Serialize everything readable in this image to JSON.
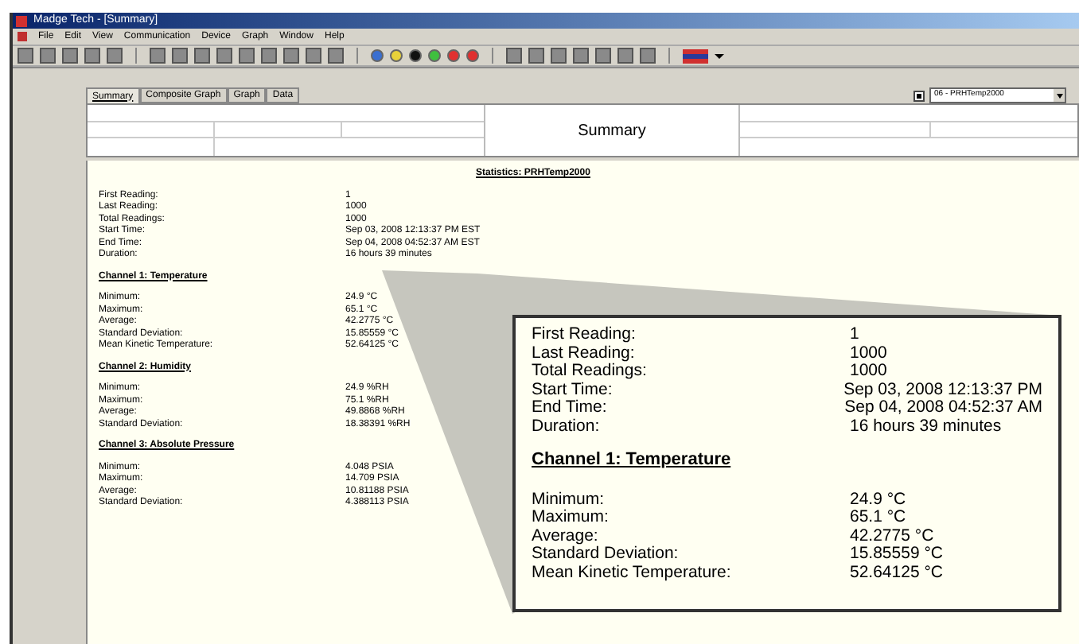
{
  "window": {
    "title": "Madge Tech - [Summary]"
  },
  "menu": [
    "File",
    "Edit",
    "View",
    "Communication",
    "Device",
    "Graph",
    "Window",
    "Help"
  ],
  "tabs": [
    {
      "label": "Summary",
      "selected": true
    },
    {
      "label": "Composite Graph",
      "selected": false
    },
    {
      "label": "Graph",
      "selected": false
    },
    {
      "label": "Data",
      "selected": false
    }
  ],
  "device_select": {
    "checked": true,
    "value": "06 - PRHTemp2000"
  },
  "header": {
    "title": "Summary"
  },
  "report": {
    "title": "Statistics: PRHTemp2000",
    "general": [
      {
        "label": "First Reading:",
        "value": "1"
      },
      {
        "label": "Last Reading:",
        "value": "1000"
      },
      {
        "label": "Total Readings:",
        "value": "1000"
      },
      {
        "label": "Start Time:",
        "value": "Sep 03, 2008 12:13:37 PM EST"
      },
      {
        "label": "End Time:",
        "value": "Sep 04, 2008 04:52:37 AM EST"
      },
      {
        "label": "Duration:",
        "value": "16 hours 39 minutes"
      }
    ],
    "channels": [
      {
        "title": "Channel 1: Temperature",
        "rows": [
          {
            "label": "Minimum:",
            "value": "24.9 °C"
          },
          {
            "label": "Maximum:",
            "value": "65.1 °C"
          },
          {
            "label": "Average:",
            "value": "42.2775 °C"
          },
          {
            "label": "Standard Deviation:",
            "value": "15.85559 °C"
          },
          {
            "label": "Mean Kinetic Temperature:",
            "value": "52.64125 °C"
          }
        ]
      },
      {
        "title": "Channel 2: Humidity",
        "rows": [
          {
            "label": "Minimum:",
            "value": "24.9 %RH"
          },
          {
            "label": "Maximum:",
            "value": "75.1 %RH"
          },
          {
            "label": "Average:",
            "value": "49.8868 %RH"
          },
          {
            "label": "Standard Deviation:",
            "value": "18.38391 %RH"
          }
        ]
      },
      {
        "title": "Channel 3: Absolute Pressure",
        "rows": [
          {
            "label": "Minimum:",
            "value": "4.048 PSIA"
          },
          {
            "label": "Maximum:",
            "value": "14.709 PSIA"
          },
          {
            "label": "Average:",
            "value": "10.81188 PSIA"
          },
          {
            "label": "Standard Deviation:",
            "value": "4.388113 PSIA"
          }
        ]
      }
    ]
  },
  "callout": {
    "general": [
      {
        "label": "First Reading:",
        "value": "1"
      },
      {
        "label": "Last Reading:",
        "value": "1000"
      },
      {
        "label": "Total Readings:",
        "value": "1000"
      },
      {
        "label": "Start Time:",
        "value": "Sep 03, 2008 12:13:37 PM"
      },
      {
        "label": "End Time:",
        "value": "Sep 04, 2008 04:52:37 AM"
      },
      {
        "label": "Duration:",
        "value": "16 hours 39 minutes"
      }
    ],
    "channel": {
      "title": "Channel 1: Temperature",
      "rows": [
        {
          "label": "Minimum:",
          "value": "24.9 °C"
        },
        {
          "label": "Maximum:",
          "value": "65.1 °C"
        },
        {
          "label": "Average:",
          "value": "42.2775 °C"
        },
        {
          "label": "Standard Deviation:",
          "value": "15.85559 °C"
        },
        {
          "label": "Mean Kinetic Temperature:",
          "value": "52.64125 °C"
        }
      ]
    }
  }
}
